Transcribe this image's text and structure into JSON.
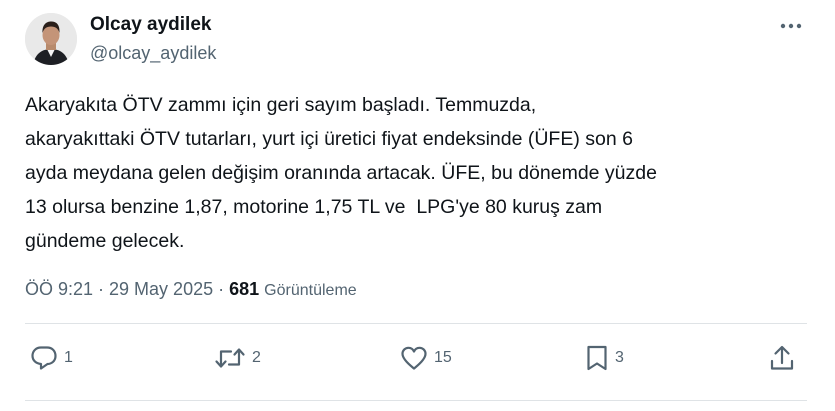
{
  "author": {
    "display_name": "Olcay aydilek",
    "handle": "@olcay_aydilek",
    "avatar_icon": "profile-photo"
  },
  "tweet": {
    "text": "Akaryakıta ÖTV zammı için geri sayım başladı. Temmuzda,\nakaryakıttaki ÖTV tutarları, yurt içi üretici fiyat endeksinde (ÜFE) son 6\nayda meydana gelen değişim oranında artacak. ÜFE, bu dönemde yüzde\n13 olursa benzine 1,87, motorine 1,75 TL ve  LPG'ye 80 kuruş zam\ngündeme gelecek."
  },
  "meta": {
    "timestamp": "ÖÖ 9:21 · 29 May 2025 · ",
    "views_count": "681",
    "views_label": "Görüntüleme"
  },
  "actions": {
    "reply_count": "1",
    "retweet_count": "2",
    "like_count": "15",
    "bookmark_count": "3"
  },
  "colors": {
    "text_primary": "#0f1419",
    "text_secondary": "#536471",
    "divider": "#dfe3e6"
  }
}
